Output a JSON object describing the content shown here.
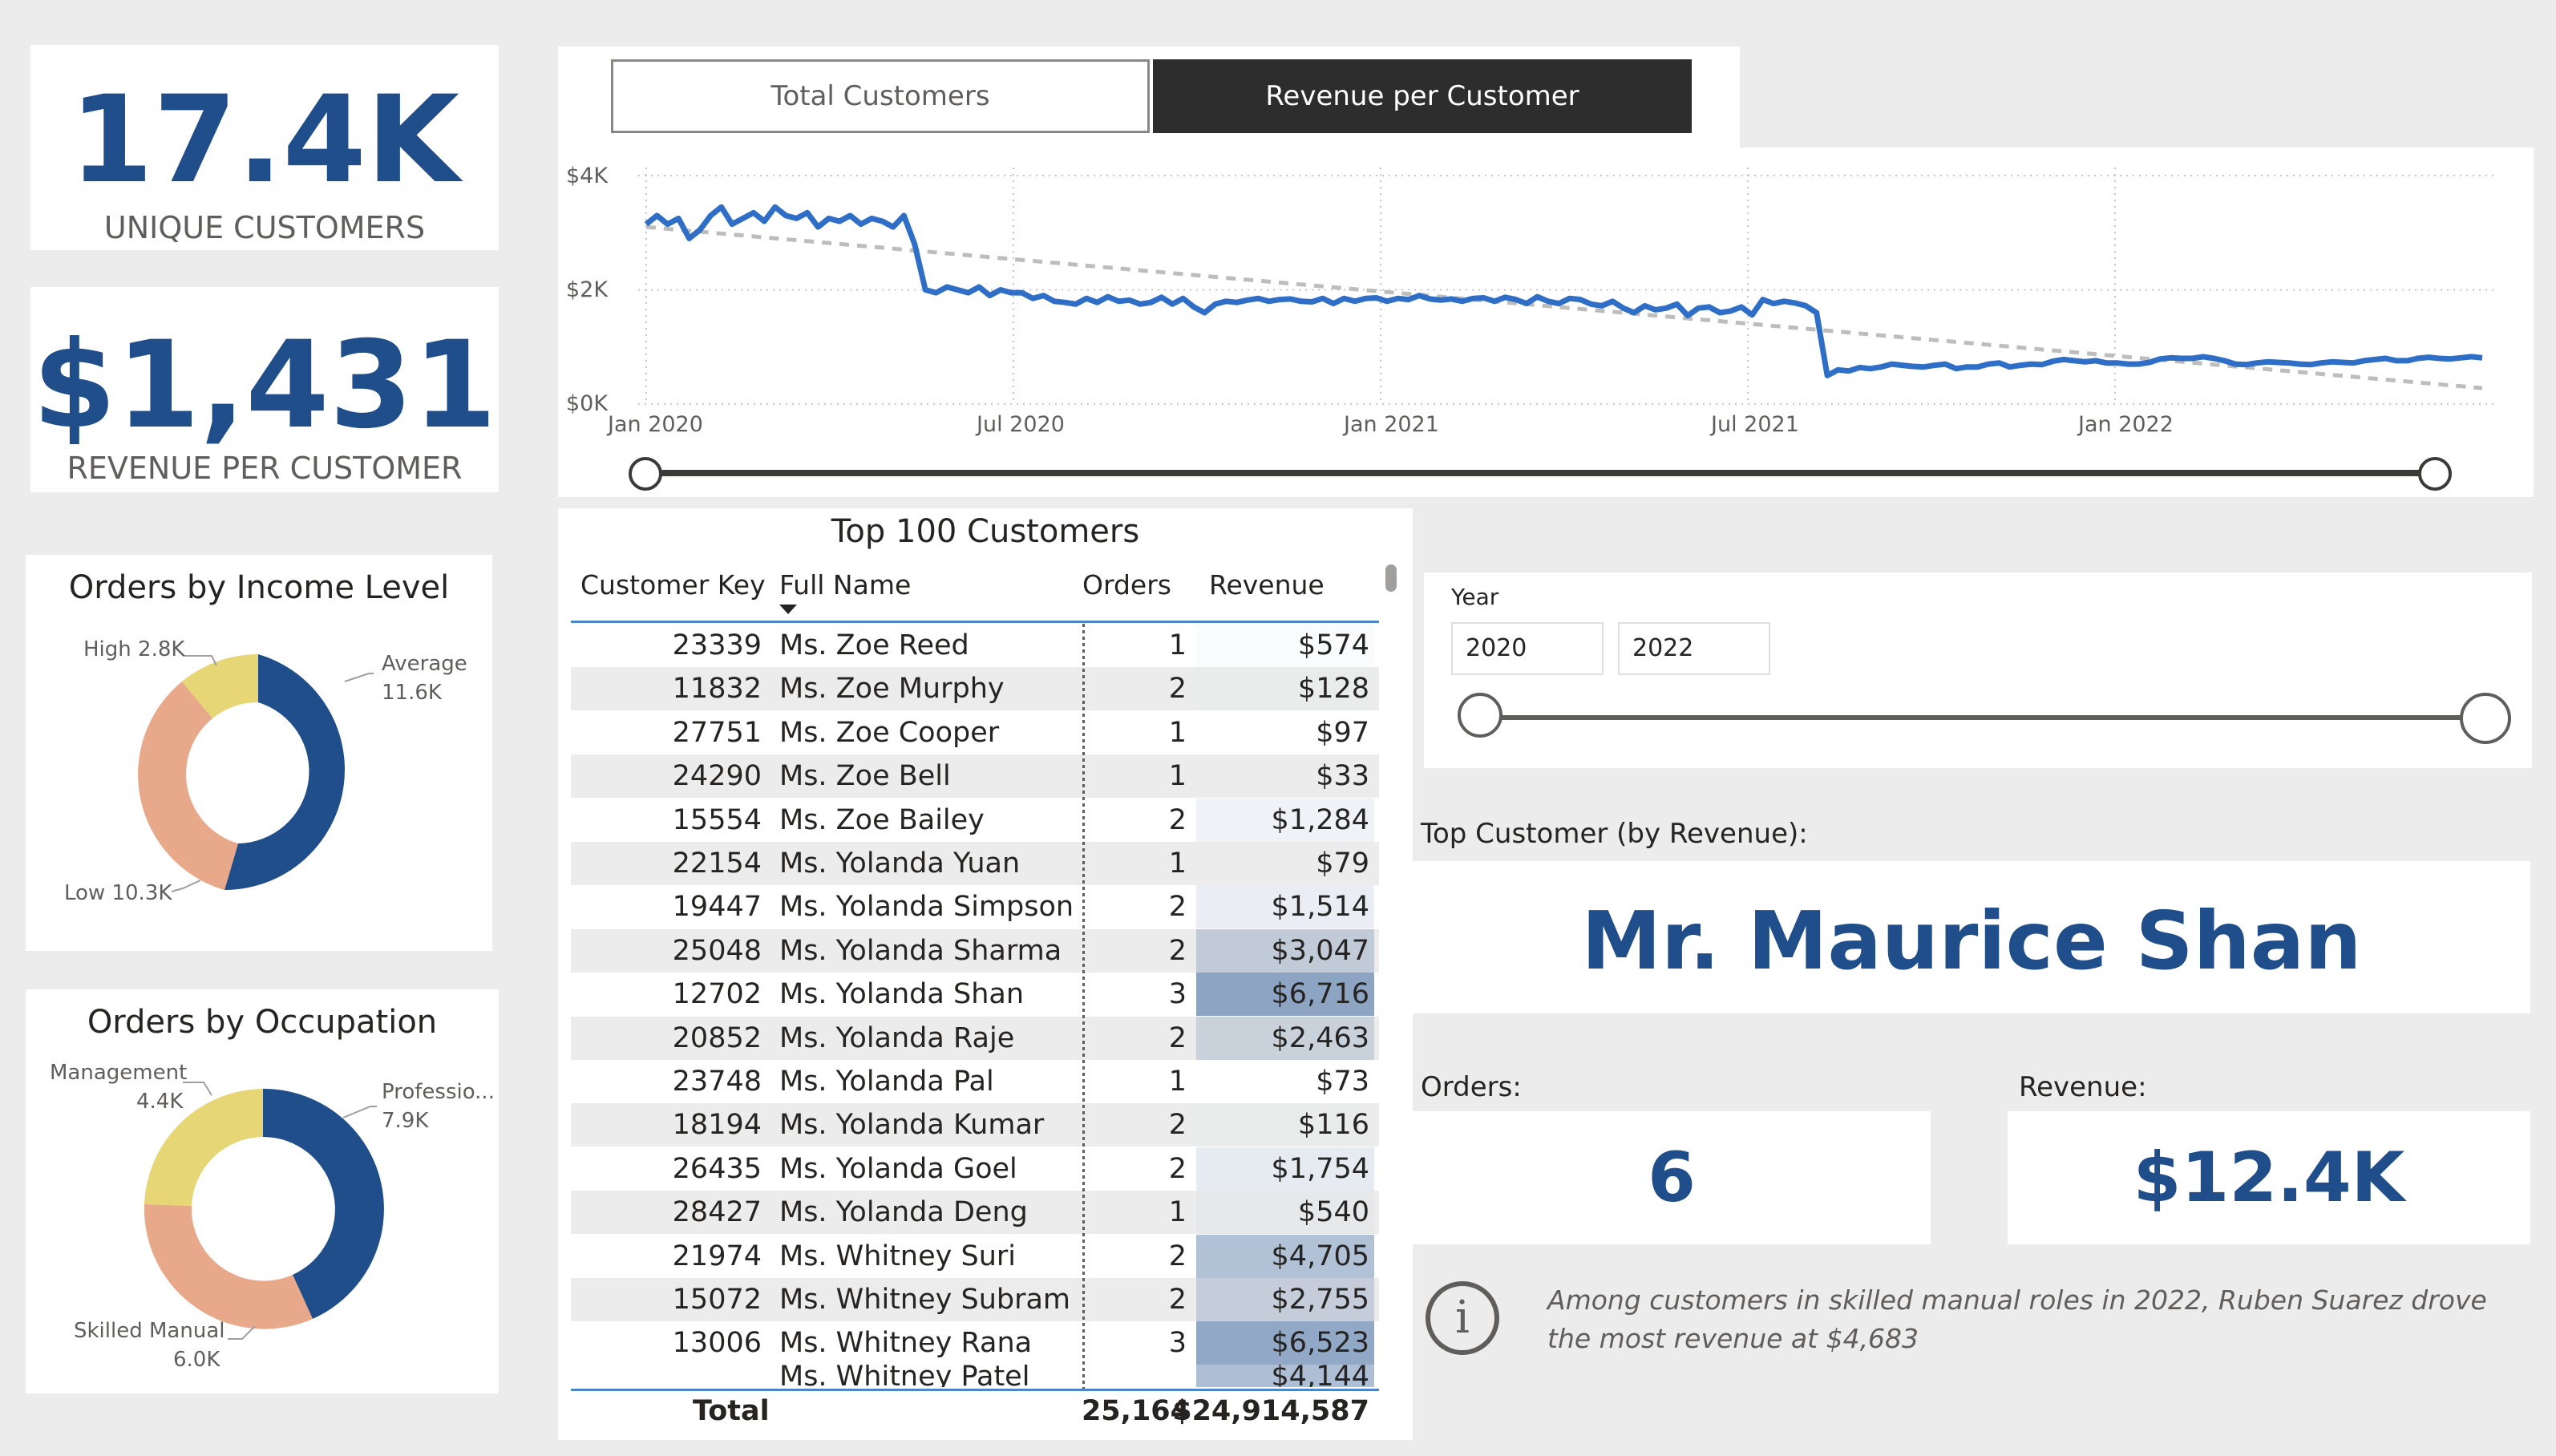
{
  "kpis": {
    "customers": {
      "value": "17.4K",
      "label": "UNIQUE CUSTOMERS"
    },
    "revenue_per_customer": {
      "value": "$1,431",
      "label": "REVENUE PER CUSTOMER"
    }
  },
  "income_donut": {
    "title": "Orders by Income Level",
    "labels": {
      "high": "High 2.8K",
      "average_name": "Average",
      "average_value": "11.6K",
      "low": "Low 10.3K"
    },
    "colors": {
      "average": "#1f4e8a",
      "low": "#e8a98a",
      "high": "#e6d675"
    }
  },
  "occupation_donut": {
    "title": "Orders by Occupation",
    "labels": {
      "management_name": "Management",
      "management_value": "4.4K",
      "professional_name": "Professio...",
      "professional_value": "7.9K",
      "skilled_name": "Skilled Manual",
      "skilled_value": "6.0K"
    }
  },
  "tabs": {
    "total_customers": "Total Customers",
    "revenue_per_customer": "Revenue per Customer",
    "active": "revenue_per_customer"
  },
  "trend_chart": {
    "y_ticks": [
      "$4K",
      "$2K",
      "$0K"
    ],
    "x_ticks": [
      "Jan 2020",
      "Jul 2020",
      "Jan 2021",
      "Jul 2021",
      "Jan 2022"
    ],
    "line_color": "#2f6ec6"
  },
  "chart_data": [
    {
      "type": "line",
      "x_start": "Jan 2020",
      "interval": "week",
      "ylim": [
        0,
        4000
      ],
      "series": [
        {
          "values": [
            3150,
            3300,
            3150,
            3250,
            2900,
            3050,
            3300,
            3450,
            3150,
            3250,
            3350,
            3200,
            3450,
            3300,
            3250,
            3350,
            3100,
            3250,
            3200,
            3300,
            3150,
            3250,
            3200,
            3100,
            3300,
            2800,
            2000,
            1950,
            2050,
            2000,
            1950,
            2050,
            1900,
            2000,
            1950,
            1950,
            1850,
            1900,
            1800,
            1780,
            1750,
            1850,
            1780,
            1880,
            1800,
            1820,
            1750,
            1780,
            1870,
            1750,
            1850,
            1700,
            1600,
            1750,
            1800,
            1780,
            1820,
            1850,
            1800,
            1830,
            1840,
            1800,
            1790,
            1850,
            1760,
            1850,
            1800,
            1850,
            1860,
            1800,
            1850,
            1830,
            1900,
            1840,
            1820,
            1840,
            1800,
            1850,
            1860,
            1800,
            1870,
            1830,
            1760,
            1880,
            1800,
            1760,
            1850,
            1830,
            1750,
            1720,
            1800,
            1680,
            1600,
            1720,
            1650,
            1680,
            1750,
            1550,
            1680,
            1700,
            1600,
            1630,
            1700,
            1560,
            1830,
            1760,
            1800,
            1770,
            1720,
            1600,
            500,
            600,
            580,
            640,
            620,
            650,
            700,
            680,
            660,
            650,
            680,
            700,
            620,
            650,
            650,
            700,
            720,
            650,
            680,
            700,
            690,
            750,
            780,
            760,
            740,
            760,
            720,
            720,
            700,
            700,
            730,
            790,
            810,
            800,
            800,
            830,
            800,
            760,
            700,
            690,
            720,
            740,
            730,
            720,
            700,
            690,
            720,
            740,
            730,
            720,
            760,
            780,
            800,
            760,
            760,
            800,
            820,
            800,
            790,
            810,
            830,
            810
          ]
        },
        {
          "name": "trend",
          "values": [
            3100,
            280
          ]
        }
      ]
    }
  ],
  "top_table": {
    "title": "Top 100 Customers",
    "headers": {
      "key": "Customer Key",
      "name": "Full Name",
      "orders": "Orders",
      "revenue": "Revenue"
    },
    "rows": [
      {
        "key": "23339",
        "name": "Ms. Zoe Reed",
        "orders": "1",
        "revenue": "$574",
        "shade": 0.04
      },
      {
        "key": "11832",
        "name": "Ms. Zoe Murphy",
        "orders": "2",
        "revenue": "$128",
        "shade": 0.01
      },
      {
        "key": "27751",
        "name": "Ms. Zoe Cooper",
        "orders": "1",
        "revenue": "$97",
        "shade": 0.0
      },
      {
        "key": "24290",
        "name": "Ms. Zoe Bell",
        "orders": "1",
        "revenue": "$33",
        "shade": 0.0
      },
      {
        "key": "15554",
        "name": "Ms. Zoe Bailey",
        "orders": "2",
        "revenue": "$1,284",
        "shade": 0.12
      },
      {
        "key": "22154",
        "name": "Ms. Yolanda Yuan",
        "orders": "1",
        "revenue": "$79",
        "shade": 0.0
      },
      {
        "key": "19447",
        "name": "Ms. Yolanda Simpson",
        "orders": "2",
        "revenue": "$1,514",
        "shade": 0.16
      },
      {
        "key": "25048",
        "name": "Ms. Yolanda Sharma",
        "orders": "2",
        "revenue": "$3,047",
        "shade": 0.35
      },
      {
        "key": "12702",
        "name": "Ms. Yolanda Shan",
        "orders": "3",
        "revenue": "$6,716",
        "shade": 0.85
      },
      {
        "key": "20852",
        "name": "Ms. Yolanda Raje",
        "orders": "2",
        "revenue": "$2,463",
        "shade": 0.28
      },
      {
        "key": "23748",
        "name": "Ms. Yolanda Pal",
        "orders": "1",
        "revenue": "$73",
        "shade": 0.0
      },
      {
        "key": "18194",
        "name": "Ms. Yolanda Kumar",
        "orders": "2",
        "revenue": "$116",
        "shade": 0.01
      },
      {
        "key": "26435",
        "name": "Ms. Yolanda Goel",
        "orders": "2",
        "revenue": "$1,754",
        "shade": 0.19
      },
      {
        "key": "28427",
        "name": "Ms. Yolanda Deng",
        "orders": "1",
        "revenue": "$540",
        "shade": 0.04
      },
      {
        "key": "21974",
        "name": "Ms. Whitney Suri",
        "orders": "2",
        "revenue": "$4,705",
        "shade": 0.58
      },
      {
        "key": "15072",
        "name": "Ms. Whitney Subram",
        "orders": "2",
        "revenue": "$2,755",
        "shade": 0.32
      },
      {
        "key": "13006",
        "name": "Ms. Whitney Rana",
        "orders": "3",
        "revenue": "$6,523",
        "shade": 0.82
      }
    ],
    "partial_row": {
      "name": "Ms. Whitney Patel",
      "revenue": "$4,144"
    },
    "total": {
      "label": "Total",
      "orders": "25,164",
      "revenue": "$24,914,587"
    }
  },
  "year_filter": {
    "label": "Year",
    "from": "2020",
    "to": "2022"
  },
  "top_customer": {
    "label": "Top Customer (by Revenue):",
    "name": "Mr. Maurice Shan",
    "orders_label": "Orders:",
    "orders": "6",
    "revenue_label": "Revenue:",
    "revenue": "$12.4K"
  },
  "insight": {
    "text": "Among customers in skilled manual roles in 2022, Ruben Suarez drove the most revenue at $4,683"
  }
}
